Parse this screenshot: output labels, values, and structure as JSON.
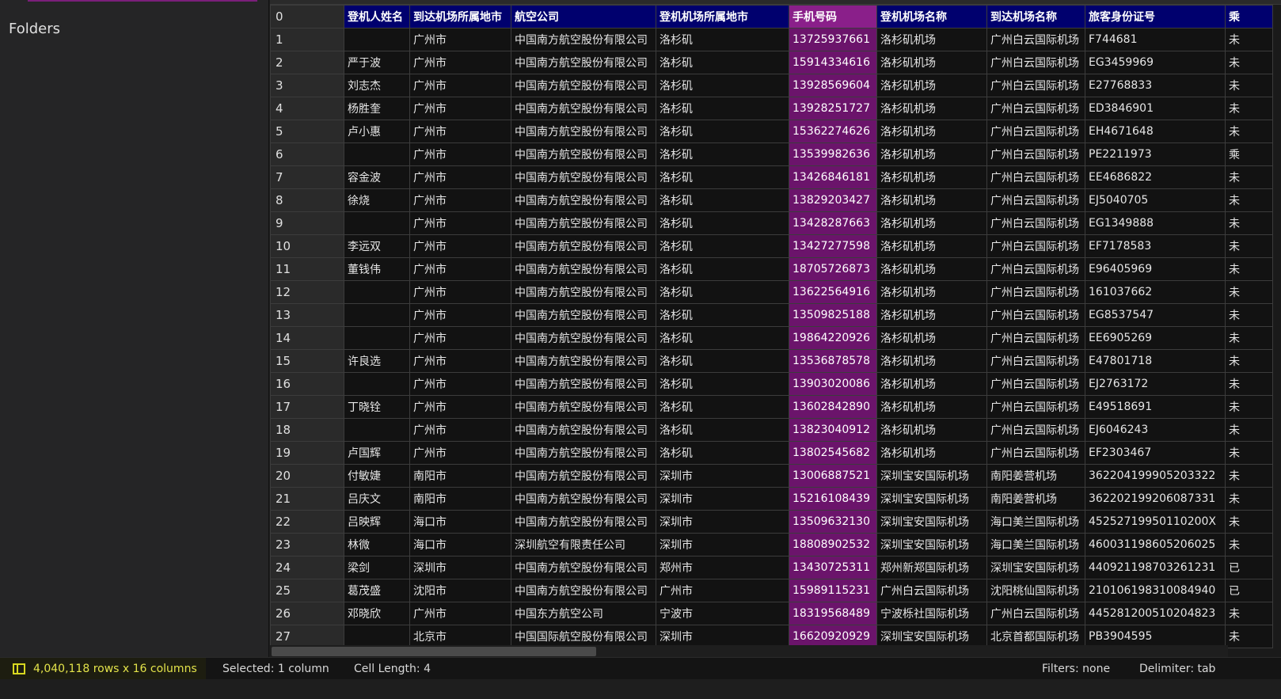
{
  "sidebar": {
    "folders_label": "Folders"
  },
  "table": {
    "index_header": "0",
    "columns": [
      "登机人姓名",
      "到达机场所属地市",
      "航空公司",
      "登机机场所属地市",
      "手机号码",
      "登机机场名称",
      "到达机场名称",
      "旅客身份证号",
      "乘"
    ],
    "selected_column": 4,
    "rows": [
      [
        "1",
        "",
        "广州市",
        "中国南方航空股份有限公司",
        "洛杉矶",
        "13725937661",
        "洛杉矶机场",
        "广州白云国际机场",
        "F744681",
        "未"
      ],
      [
        "2",
        "严于波",
        "广州市",
        "中国南方航空股份有限公司",
        "洛杉矶",
        "15914334616",
        "洛杉矶机场",
        "广州白云国际机场",
        "EG3459969",
        "未"
      ],
      [
        "3",
        "刘志杰",
        "广州市",
        "中国南方航空股份有限公司",
        "洛杉矶",
        "13928569604",
        "洛杉矶机场",
        "广州白云国际机场",
        "E27768833",
        "未"
      ],
      [
        "4",
        "杨胜奎",
        "广州市",
        "中国南方航空股份有限公司",
        "洛杉矶",
        "13928251727",
        "洛杉矶机场",
        "广州白云国际机场",
        "ED3846901",
        "未"
      ],
      [
        "5",
        "卢小惠",
        "广州市",
        "中国南方航空股份有限公司",
        "洛杉矶",
        "15362274626",
        "洛杉矶机场",
        "广州白云国际机场",
        "EH4671648",
        "未"
      ],
      [
        "6",
        "",
        "广州市",
        "中国南方航空股份有限公司",
        "洛杉矶",
        "13539982636",
        "洛杉矶机场",
        "广州白云国际机场",
        "PE2211973",
        "乘"
      ],
      [
        "7",
        "容金波",
        "广州市",
        "中国南方航空股份有限公司",
        "洛杉矶",
        "13426846181",
        "洛杉矶机场",
        "广州白云国际机场",
        "EE4686822",
        "未"
      ],
      [
        "8",
        "徐烧",
        "广州市",
        "中国南方航空股份有限公司",
        "洛杉矶",
        "13829203427",
        "洛杉矶机场",
        "广州白云国际机场",
        "EJ5040705",
        "未"
      ],
      [
        "9",
        "",
        "广州市",
        "中国南方航空股份有限公司",
        "洛杉矶",
        "13428287663",
        "洛杉矶机场",
        "广州白云国际机场",
        "EG1349888",
        "未"
      ],
      [
        "10",
        "李远双",
        "广州市",
        "中国南方航空股份有限公司",
        "洛杉矶",
        "13427277598",
        "洛杉矶机场",
        "广州白云国际机场",
        "EF7178583",
        "未"
      ],
      [
        "11",
        "董钱伟",
        "广州市",
        "中国南方航空股份有限公司",
        "洛杉矶",
        "18705726873",
        "洛杉矶机场",
        "广州白云国际机场",
        "E96405969",
        "未"
      ],
      [
        "12",
        "",
        "广州市",
        "中国南方航空股份有限公司",
        "洛杉矶",
        "13622564916",
        "洛杉矶机场",
        "广州白云国际机场",
        "161037662",
        "未"
      ],
      [
        "13",
        "",
        "广州市",
        "中国南方航空股份有限公司",
        "洛杉矶",
        "13509825188",
        "洛杉矶机场",
        "广州白云国际机场",
        "EG8537547",
        "未"
      ],
      [
        "14",
        "",
        "广州市",
        "中国南方航空股份有限公司",
        "洛杉矶",
        "19864220926",
        "洛杉矶机场",
        "广州白云国际机场",
        "EE6905269",
        "未"
      ],
      [
        "15",
        "许良选",
        "广州市",
        "中国南方航空股份有限公司",
        "洛杉矶",
        "13536878578",
        "洛杉矶机场",
        "广州白云国际机场",
        "E47801718",
        "未"
      ],
      [
        "16",
        "",
        "广州市",
        "中国南方航空股份有限公司",
        "洛杉矶",
        "13903020086",
        "洛杉矶机场",
        "广州白云国际机场",
        "EJ2763172",
        "未"
      ],
      [
        "17",
        "丁晓铨",
        "广州市",
        "中国南方航空股份有限公司",
        "洛杉矶",
        "13602842890",
        "洛杉矶机场",
        "广州白云国际机场",
        "E49518691",
        "未"
      ],
      [
        "18",
        "",
        "广州市",
        "中国南方航空股份有限公司",
        "洛杉矶",
        "13823040912",
        "洛杉矶机场",
        "广州白云国际机场",
        "EJ6046243",
        "未"
      ],
      [
        "19",
        "卢国辉",
        "广州市",
        "中国南方航空股份有限公司",
        "洛杉矶",
        "13802545682",
        "洛杉矶机场",
        "广州白云国际机场",
        "EF2303467",
        "未"
      ],
      [
        "20",
        "付敏婕",
        "南阳市",
        "中国南方航空股份有限公司",
        "深圳市",
        "13006887521",
        "深圳宝安国际机场",
        "南阳姜营机场",
        "362204199905203322",
        "未"
      ],
      [
        "21",
        "吕庆文",
        "南阳市",
        "中国南方航空股份有限公司",
        "深圳市",
        "15216108439",
        "深圳宝安国际机场",
        "南阳姜营机场",
        "362202199206087331",
        "未"
      ],
      [
        "22",
        "吕映辉",
        "海口市",
        "中国南方航空股份有限公司",
        "深圳市",
        "13509632130",
        "深圳宝安国际机场",
        "海口美兰国际机场",
        "45252719950110200X",
        "未"
      ],
      [
        "23",
        "林微",
        "海口市",
        "深圳航空有限责任公司",
        "深圳市",
        "18808902532",
        "深圳宝安国际机场",
        "海口美兰国际机场",
        "460031198605206025",
        "未"
      ],
      [
        "24",
        "梁剑",
        "深圳市",
        "中国南方航空股份有限公司",
        "郑州市",
        "13430725311",
        "郑州新郑国际机场",
        "深圳宝安国际机场",
        "440921198703261231",
        "已"
      ],
      [
        "25",
        "葛茂盛",
        "沈阳市",
        "中国南方航空股份有限公司",
        "广州市",
        "15989115231",
        "广州白云国际机场",
        "沈阳桃仙国际机场",
        "210106198310084940",
        "已"
      ],
      [
        "26",
        "邓晓欣",
        "广州市",
        "中国东方航空公司",
        "宁波市",
        "18319568489",
        "宁波栎社国际机场",
        "广州白云国际机场",
        "445281200510204823",
        "未"
      ],
      [
        "27",
        "",
        "北京市",
        "中国国际航空股份有限公司",
        "深圳市",
        "16620920929",
        "深圳宝安国际机场",
        "北京首都国际机场",
        "PB3904595",
        "未"
      ]
    ]
  },
  "status": {
    "rows_cols": "4,040,118 rows x 16 columns",
    "selected": "Selected: 1 column",
    "cell_length": "Cell Length: 4",
    "filters": "Filters: none",
    "delimiter": "Delimiter: tab"
  },
  "colors": {
    "header_bg": "#00006e",
    "selected_header_bg": "#8a1f8a",
    "selected_cell_bg": "#6b146b",
    "status_rows_text": "#e3e34a"
  }
}
